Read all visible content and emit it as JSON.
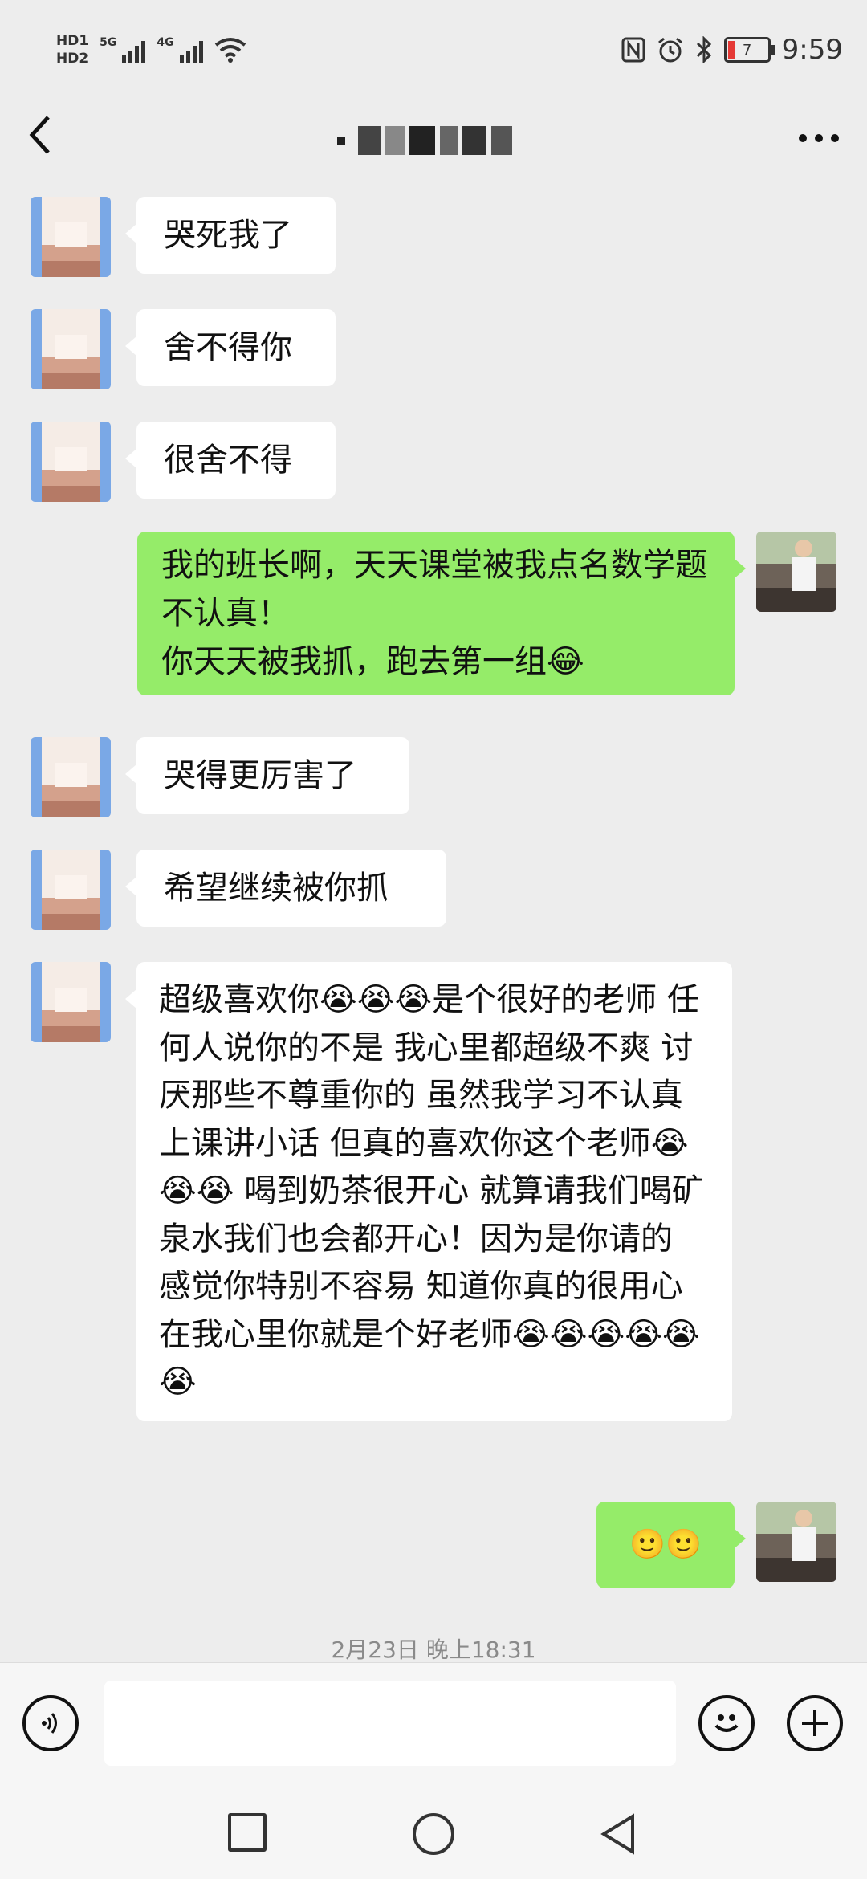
{
  "status_bar": {
    "hd1": "HD1",
    "hd2": "HD2",
    "net1": "5G",
    "net2": "4G",
    "battery": "7",
    "time": "9:59",
    "icons": [
      "nfc-icon",
      "alarm-icon",
      "bluetooth-icon",
      "wifi-icon",
      "battery-icon"
    ]
  },
  "header": {
    "back_icon": "chevron-left-icon",
    "more_icon": "more-dots-icon"
  },
  "messages": [
    {
      "from": "them",
      "text": "哭死我了"
    },
    {
      "from": "them",
      "text": "舍不得你"
    },
    {
      "from": "them",
      "text": "很舍不得"
    },
    {
      "from": "me",
      "text": "我的班长啊，天天课堂被我点名数学题不认真！\n你天天被我抓，跑去第一组😂"
    },
    {
      "from": "them",
      "text": "哭得更厉害了"
    },
    {
      "from": "them",
      "text": "希望继续被你抓"
    },
    {
      "from": "them",
      "text": "超级喜欢你😭😭😭是个很好的老师 任何人说你的不是 我心里都超级不爽 讨厌那些不尊重你的 虽然我学习不认真 上课讲小话 但真的喜欢你这个老师😭😭😭 喝到奶茶很开心 就算请我们喝矿泉水我们也会都开心！因为是你请的 感觉你特别不容易 知道你真的很用心 在我心里你就是个好老师😭😭😭😭😭😭"
    },
    {
      "from": "me",
      "text": "🙂🙂"
    }
  ],
  "timestamp": "2月23日 晚上18:31",
  "input_bar": {
    "voice_icon": "voice-icon",
    "input_value": "",
    "emoji_icon": "emoji-icon",
    "plus_icon": "plus-icon"
  },
  "nav_bar": {
    "icons": [
      "recent-apps-icon",
      "home-icon",
      "back-icon"
    ]
  }
}
